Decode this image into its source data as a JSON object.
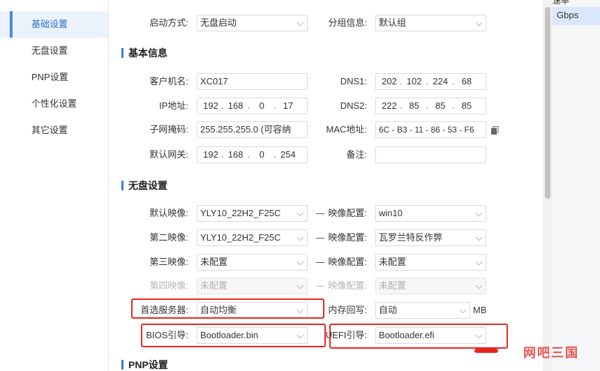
{
  "background_app": {
    "header_partial": "速率",
    "value": "Gbps"
  },
  "nav": {
    "items": [
      {
        "label": "基础设置",
        "active": true
      },
      {
        "label": "无盘设置",
        "active": false
      },
      {
        "label": "PNP设置",
        "active": false
      },
      {
        "label": "个性化设置",
        "active": false
      },
      {
        "label": "其它设置",
        "active": false
      }
    ]
  },
  "top": {
    "boot_mode_label": "启动方式:",
    "boot_mode_value": "无盘启动",
    "group_label": "分组信息:",
    "group_value": "默认组"
  },
  "basic": {
    "title": "基本信息",
    "client_name_label": "客户机名:",
    "client_name_value": "XC017",
    "dns1_label": "DNS1:",
    "dns1": [
      "202",
      "102",
      "224",
      "68"
    ],
    "ip_label": "IP地址:",
    "ip": [
      "192",
      "168",
      "0",
      "17"
    ],
    "dns2_label": "DNS2:",
    "dns2": [
      "222",
      "85",
      "85",
      "85"
    ],
    "subnet_label": "子网掩码:",
    "subnet_value": "255.255.255.0  (可容纳",
    "mac_label": "MAC地址:",
    "mac_value": "6C - B3 - 11 - 86 - 53 - F6",
    "gateway_label": "默认网关:",
    "gateway": [
      "192",
      "168",
      "0",
      "254"
    ],
    "remark_label": "备注:",
    "remark_value": ""
  },
  "diskless": {
    "title": "无盘设置",
    "rows": [
      {
        "label": "默认映像:",
        "image": "YLY10_22H2_F25C",
        "cfg_label": "映像配置:",
        "cfg": "win10",
        "disabled": false
      },
      {
        "label": "第二映像:",
        "image": "YLY10_22H2_F25C",
        "cfg_label": "映像配置:",
        "cfg": "瓦罗兰特反作弊",
        "disabled": false
      },
      {
        "label": "第三映像:",
        "image": "未配置",
        "cfg_label": "映像配置:",
        "cfg": "未配置",
        "disabled": false
      },
      {
        "label": "第四映像:",
        "image": "未配置",
        "cfg_label": "映像配置:",
        "cfg": "未配置",
        "disabled": true
      }
    ],
    "server_label": "首选服务器:",
    "server_value": "自动均衡",
    "mem_label": "内存回写:",
    "mem_value": "自动",
    "mem_unit": "MB",
    "bios_label": "BIOS引导:",
    "bios_value": "Bootloader.bin",
    "uefi_label": "UEFI引导:",
    "uefi_value": "Bootloader.efi"
  },
  "pnp": {
    "title": "PNP设置"
  },
  "watermark": "网吧三国",
  "colors": {
    "accent": "#3a7be0",
    "highlight_box": "#e8261f",
    "nav_active_bg": "#ecf2fb"
  },
  "icons": {
    "copy": "copy-icon"
  }
}
